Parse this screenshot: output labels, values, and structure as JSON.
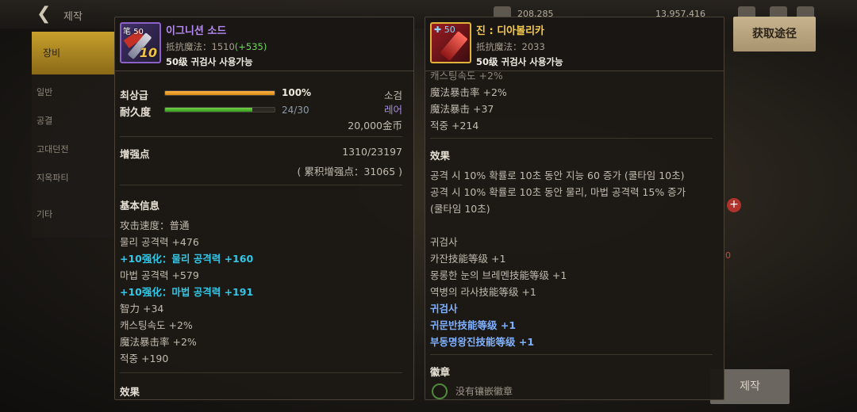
{
  "background": {
    "title": "제작",
    "stats": [
      "208,285",
      "13,957,416"
    ],
    "sidebar_active": "장비",
    "sidebar_items": [
      "일반",
      "공결",
      "고대던전",
      "지옥파티",
      "기타"
    ],
    "make_button": "제작"
  },
  "acquire_button": "获取途径",
  "left_tooltip": {
    "icon": {
      "level": "50",
      "plus": "10",
      "name": "sword-icon"
    },
    "name": "이그니션 소드",
    "sub_prefix": "抵抗魔法：1510",
    "sub_bonus": "(+535)",
    "requirement": "50级 귀검사 사용가능",
    "grade_label": "최상급",
    "grade_percent": "100%",
    "grade_fill": 1.0,
    "type_label": "소검",
    "durability_label": "耐久度",
    "durability_value": "24/30",
    "durability_fill": 0.8,
    "rarity": "레어",
    "price": "20,000金币",
    "enhance_label": "增强点",
    "enhance_value": "1310/23197",
    "enhance_total": "( 累积增强点：31065 )",
    "basic_header": "基本信息",
    "stats": [
      {
        "text": "攻击速度：普通",
        "style": "normal"
      },
      {
        "text": "물리 공격력 +476",
        "style": "normal"
      },
      {
        "text": "+10强化：물리 공격력 +160",
        "style": "cyan"
      },
      {
        "text": "마법 공격력 +579",
        "style": "normal"
      },
      {
        "text": "+10强化：마법 공격력 +191",
        "style": "cyan"
      },
      {
        "text": "智力 +34",
        "style": "normal"
      },
      {
        "text": "캐스팅속도 +2%",
        "style": "normal"
      },
      {
        "text": "魔法暴击率 +2%",
        "style": "normal"
      },
      {
        "text": "적중 +190",
        "style": "normal"
      }
    ],
    "effect_header": "效果"
  },
  "right_tooltip": {
    "icon": {
      "level": "50",
      "name": "legendary-sword-icon"
    },
    "name": "진 : 디아볼리카",
    "sub": "抵抗魔法：2033",
    "requirement": "50级 귀검사 사용가능",
    "top_cut": "캐스팅속도 +2%",
    "stats": [
      "魔法暴击率 +2%",
      "魔法暴击 +37",
      "적중 +214"
    ],
    "effect_header": "效果",
    "effects": [
      "공격 시 10% 확률로 10초 동안 지능 60 증가 (쿨타임 10초)",
      "공격 시 10% 확률로 10초 동안 물리, 마법 공격력 15% 증가",
      "(쿨타임 10초)"
    ],
    "class_header": "귀검사",
    "skills": [
      "카잔技能等级 +1",
      "몽롱한 눈의 브레멘技能等级 +1",
      "역병의 라사技能等级 +1"
    ],
    "class_header2": "귀검사",
    "skills_blue": [
      "귀문반技能等级 +1",
      "부동명왕진技能等级 +1"
    ],
    "emblem_header": "徽章",
    "emblem_cut": "没有镶嵌徽章"
  }
}
